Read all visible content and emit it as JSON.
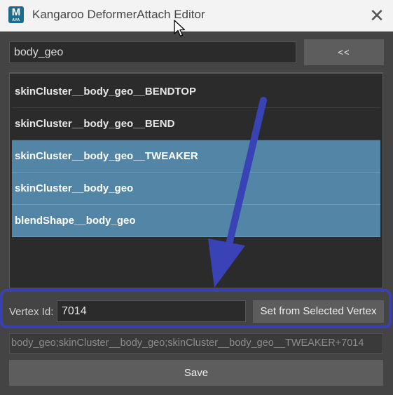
{
  "window": {
    "title": "Kangaroo DeformerAttach Editor",
    "app_icon_letter": "M",
    "app_icon_sub": "AYA",
    "close_glyph": "✕"
  },
  "search": {
    "value": "body_geo",
    "back_label": "<<"
  },
  "deformers": [
    {
      "label": "skinCluster__body_geo__BENDTOP",
      "selected": false
    },
    {
      "label": "skinCluster__body_geo__BEND",
      "selected": false
    },
    {
      "label": "skinCluster__body_geo__TWEAKER",
      "selected": true
    },
    {
      "label": "skinCluster__body_geo",
      "selected": true
    },
    {
      "label": "blendShape__body_geo",
      "selected": true
    }
  ],
  "vertex": {
    "label": "Vertex Id:",
    "value": "7014",
    "set_button_label": "Set from Selected Vertex"
  },
  "result_string": "body_geo;skinCluster__body_geo;skinCluster__body_geo__TWEAKER+7014",
  "save_label": "Save",
  "colors": {
    "highlight_box": "#3940b0",
    "arrow": "#3a43b5",
    "selection": "#5285a6"
  }
}
